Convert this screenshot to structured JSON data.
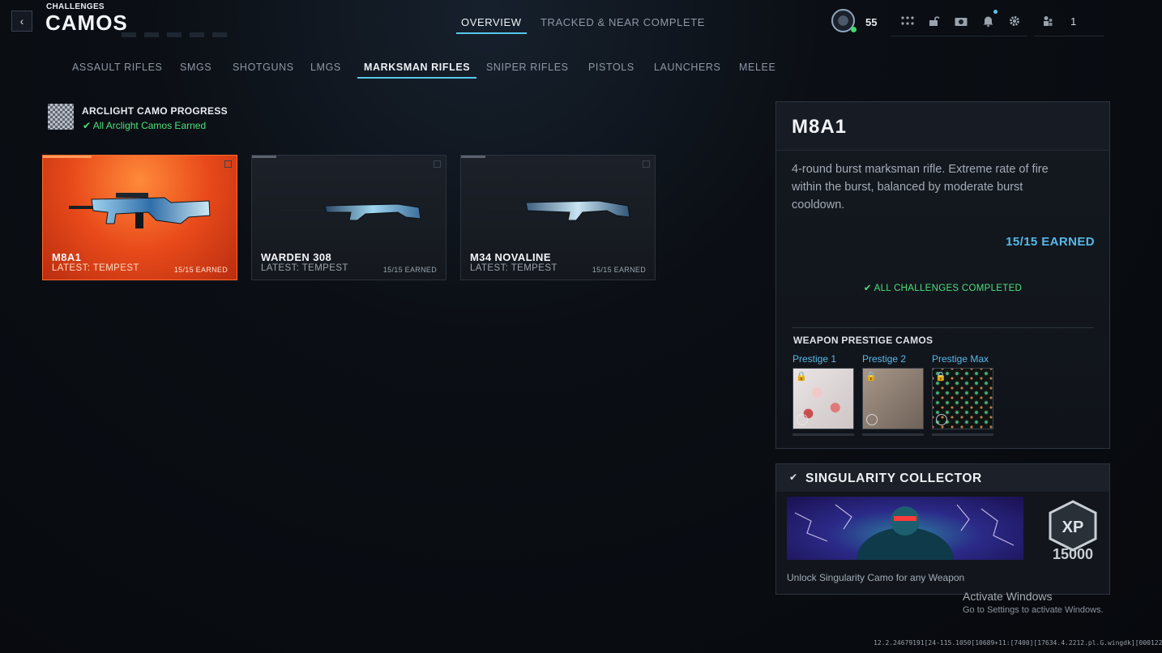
{
  "header": {
    "breadcrumb": "CHALLENGES",
    "title": "CAMOS",
    "tabs": [
      {
        "label": "OVERVIEW",
        "active": true
      },
      {
        "label": "TRACKED & NEAR COMPLETE",
        "active": false
      }
    ],
    "rank_level": "55",
    "party_count": "1",
    "icons": [
      "grid-icon",
      "unlock-icon",
      "camera-icon",
      "bell-icon",
      "gear-icon",
      "party-icon"
    ]
  },
  "categories": [
    {
      "label": "ASSAULT RIFLES",
      "active": false
    },
    {
      "label": "SMGS",
      "active": false
    },
    {
      "label": "SHOTGUNS",
      "active": false
    },
    {
      "label": "LMGS",
      "active": false
    },
    {
      "label": "MARKSMAN RIFLES",
      "active": true
    },
    {
      "label": "SNIPER RIFLES",
      "active": false
    },
    {
      "label": "PISTOLS",
      "active": false
    },
    {
      "label": "LAUNCHERS",
      "active": false
    },
    {
      "label": "MELEE",
      "active": false
    }
  ],
  "arclight": {
    "title": "ARCLIGHT CAMO PROGRESS",
    "status": "All Arclight Camos Earned"
  },
  "weapons": [
    {
      "name": "M8A1",
      "latest": "LATEST: TEMPEST",
      "earned": "15/15 EARNED",
      "selected": true
    },
    {
      "name": "WARDEN 308",
      "latest": "LATEST: TEMPEST",
      "earned": "15/15 EARNED",
      "selected": false
    },
    {
      "name": "M34 NOVALINE",
      "latest": "LATEST: TEMPEST",
      "earned": "15/15 EARNED",
      "selected": false
    }
  ],
  "detail": {
    "name": "M8A1",
    "description": "4-round burst marksman rifle. Extreme rate of fire within the burst, balanced by moderate burst cooldown.",
    "earned": "15/15 EARNED",
    "complete": "ALL CHALLENGES COMPLETED",
    "prestige_title": "WEAPON PRESTIGE CAMOS",
    "prestige": [
      {
        "label": "Prestige 1",
        "progress": 0.3
      },
      {
        "label": "Prestige 2",
        "progress": 0
      },
      {
        "label": "Prestige Max",
        "progress": 0
      }
    ]
  },
  "singularity": {
    "title": "SINGULARITY COLLECTOR",
    "xp_label": "XP",
    "xp_value": "15000",
    "description": "Unlock Singularity Camo for any Weapon"
  },
  "activation": {
    "title": "Activate Windows",
    "subtitle": "Go to Settings to activate Windows."
  },
  "build_string": "12.2.24679191[24-115.1050[10689+11:[7400][17634.4.2212.pl.G.wingdk][0001229ffff"
}
